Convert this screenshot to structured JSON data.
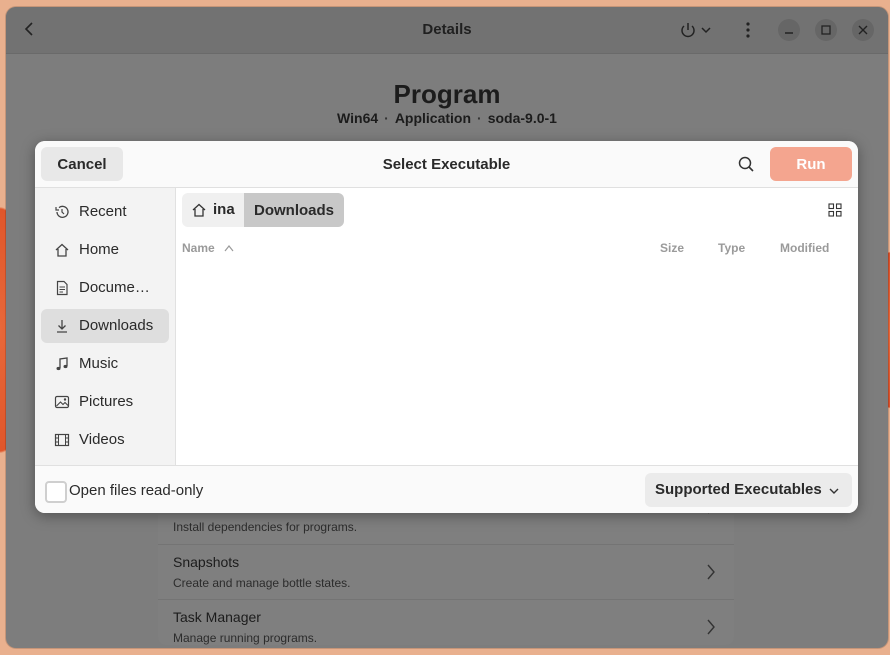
{
  "window": {
    "title": "Details",
    "program_name": "Program",
    "meta": [
      "Win64",
      "Application",
      "soda-9.0-1"
    ],
    "meta_separator": "·"
  },
  "background_list": [
    {
      "title": "",
      "description": "Install dependencies for programs."
    },
    {
      "title": "Snapshots",
      "description": "Create and manage bottle states."
    },
    {
      "title": "Task Manager",
      "description": "Manage running programs."
    }
  ],
  "dialog": {
    "title": "Select Executable",
    "cancel_label": "Cancel",
    "run_label": "Run",
    "sidebar": [
      {
        "label": "Recent",
        "icon": "clock-icon"
      },
      {
        "label": "Home",
        "icon": "home-icon"
      },
      {
        "label": "Docume…",
        "icon": "document-icon"
      },
      {
        "label": "Downloads",
        "icon": "download-icon",
        "active": true
      },
      {
        "label": "Music",
        "icon": "music-icon"
      },
      {
        "label": "Pictures",
        "icon": "picture-icon"
      },
      {
        "label": "Videos",
        "icon": "film-icon"
      }
    ],
    "breadcrumb": {
      "home": "ina",
      "current": "Downloads"
    },
    "columns": {
      "name": "Name",
      "size": "Size",
      "type": "Type",
      "modified": "Modified"
    },
    "readonly_label": "Open files read-only",
    "readonly_checked": false,
    "filter_label": "Supported Executables",
    "accent_color": "#f4a58f"
  }
}
